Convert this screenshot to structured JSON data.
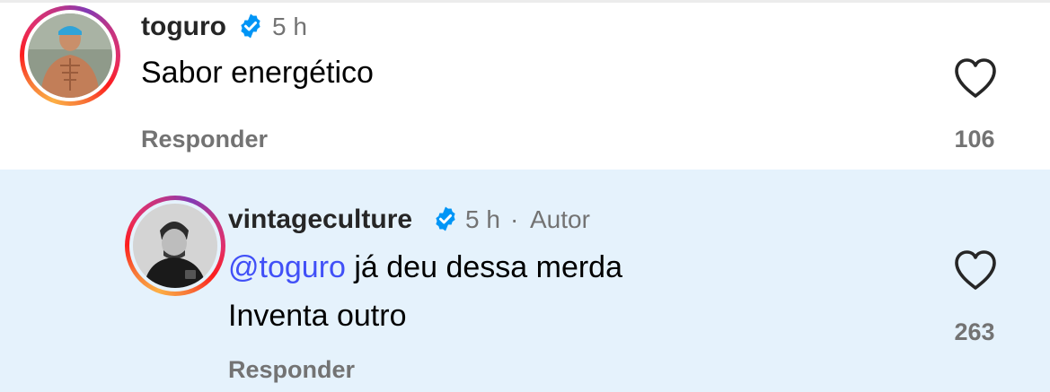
{
  "colors": {
    "reply_highlight_bg": "#e5f2fc",
    "mention": "#4150f7",
    "verified_badge": "#0095f6",
    "muted_text": "#737373"
  },
  "comments": [
    {
      "username": "toguro",
      "verified": true,
      "time": "5 h",
      "author_tag": "",
      "lines": [
        "Sabor energético"
      ],
      "reply_label": "Responder",
      "likes": "106",
      "icons": {
        "verified": "verified-badge-icon",
        "like": "heart-outline-icon"
      }
    },
    {
      "username": "vintageculture",
      "verified": true,
      "time": "5 h",
      "separator": "·",
      "author_tag": "Autor",
      "mention": "@toguro",
      "lines": [
        " já deu dessa merda",
        "Inventa outro"
      ],
      "reply_label": "Responder",
      "likes": "263",
      "icons": {
        "verified": "verified-badge-icon",
        "like": "heart-outline-icon"
      }
    }
  ]
}
